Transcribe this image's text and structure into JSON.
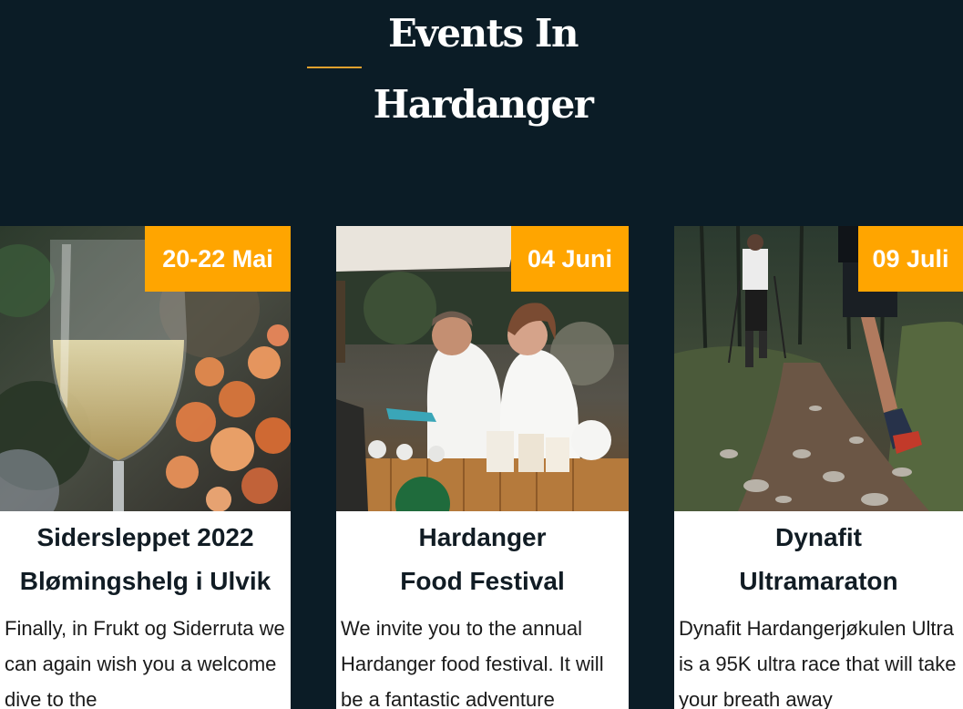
{
  "section": {
    "title_line1": "Events In",
    "title_line2": "Hardanger",
    "accent_color": "#e0a12e"
  },
  "colors": {
    "background": "#0b1c26",
    "badge": "#ffa500",
    "card": "#ffffff"
  },
  "events": [
    {
      "date": "20-22 Mai",
      "title_line1": "Sidersleppet 2022",
      "title_line2": "Blømingshelg i Ulvik",
      "description": "Finally, in Frukt og Siderruta we can again wish you a welcome dive to the",
      "image": "wine-glass-photo"
    },
    {
      "date": "04 Juni",
      "title_line1": "Hardanger",
      "title_line2": "Food Festival",
      "description": "We invite you to the annual Hardanger food festival. It will be a fantastic adventure",
      "image": "chefs-food-stall-photo"
    },
    {
      "date": "09 Juli",
      "title_line1": "Dynafit",
      "title_line2": "Ultramaraton",
      "description": "Dynafit Hardangerjøkulen Ultra is a 95K ultra race that will take your breath away",
      "image": "trail-runners-photo"
    }
  ]
}
